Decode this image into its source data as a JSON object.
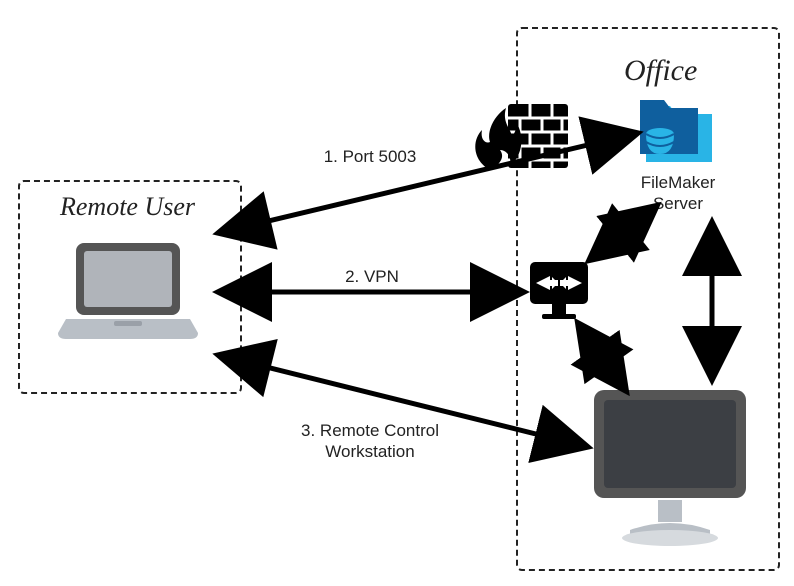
{
  "boxes": {
    "remote": {
      "title": "Remote User"
    },
    "office": {
      "title": "Office"
    }
  },
  "connections": {
    "c1": "1. Port 5003",
    "c2": "2. VPN",
    "c3_line1": "3. Remote Control",
    "c3_line2": "Workstation"
  },
  "nodes": {
    "laptop": "laptop-icon",
    "firewall": "firewall-icon",
    "filemaker_folder": "filemaker-folder-icon",
    "filemaker_label_1": "FileMaker",
    "filemaker_label_2": "Server",
    "vpn_router": "vpn-router-icon",
    "workstation": "workstation-icon"
  }
}
